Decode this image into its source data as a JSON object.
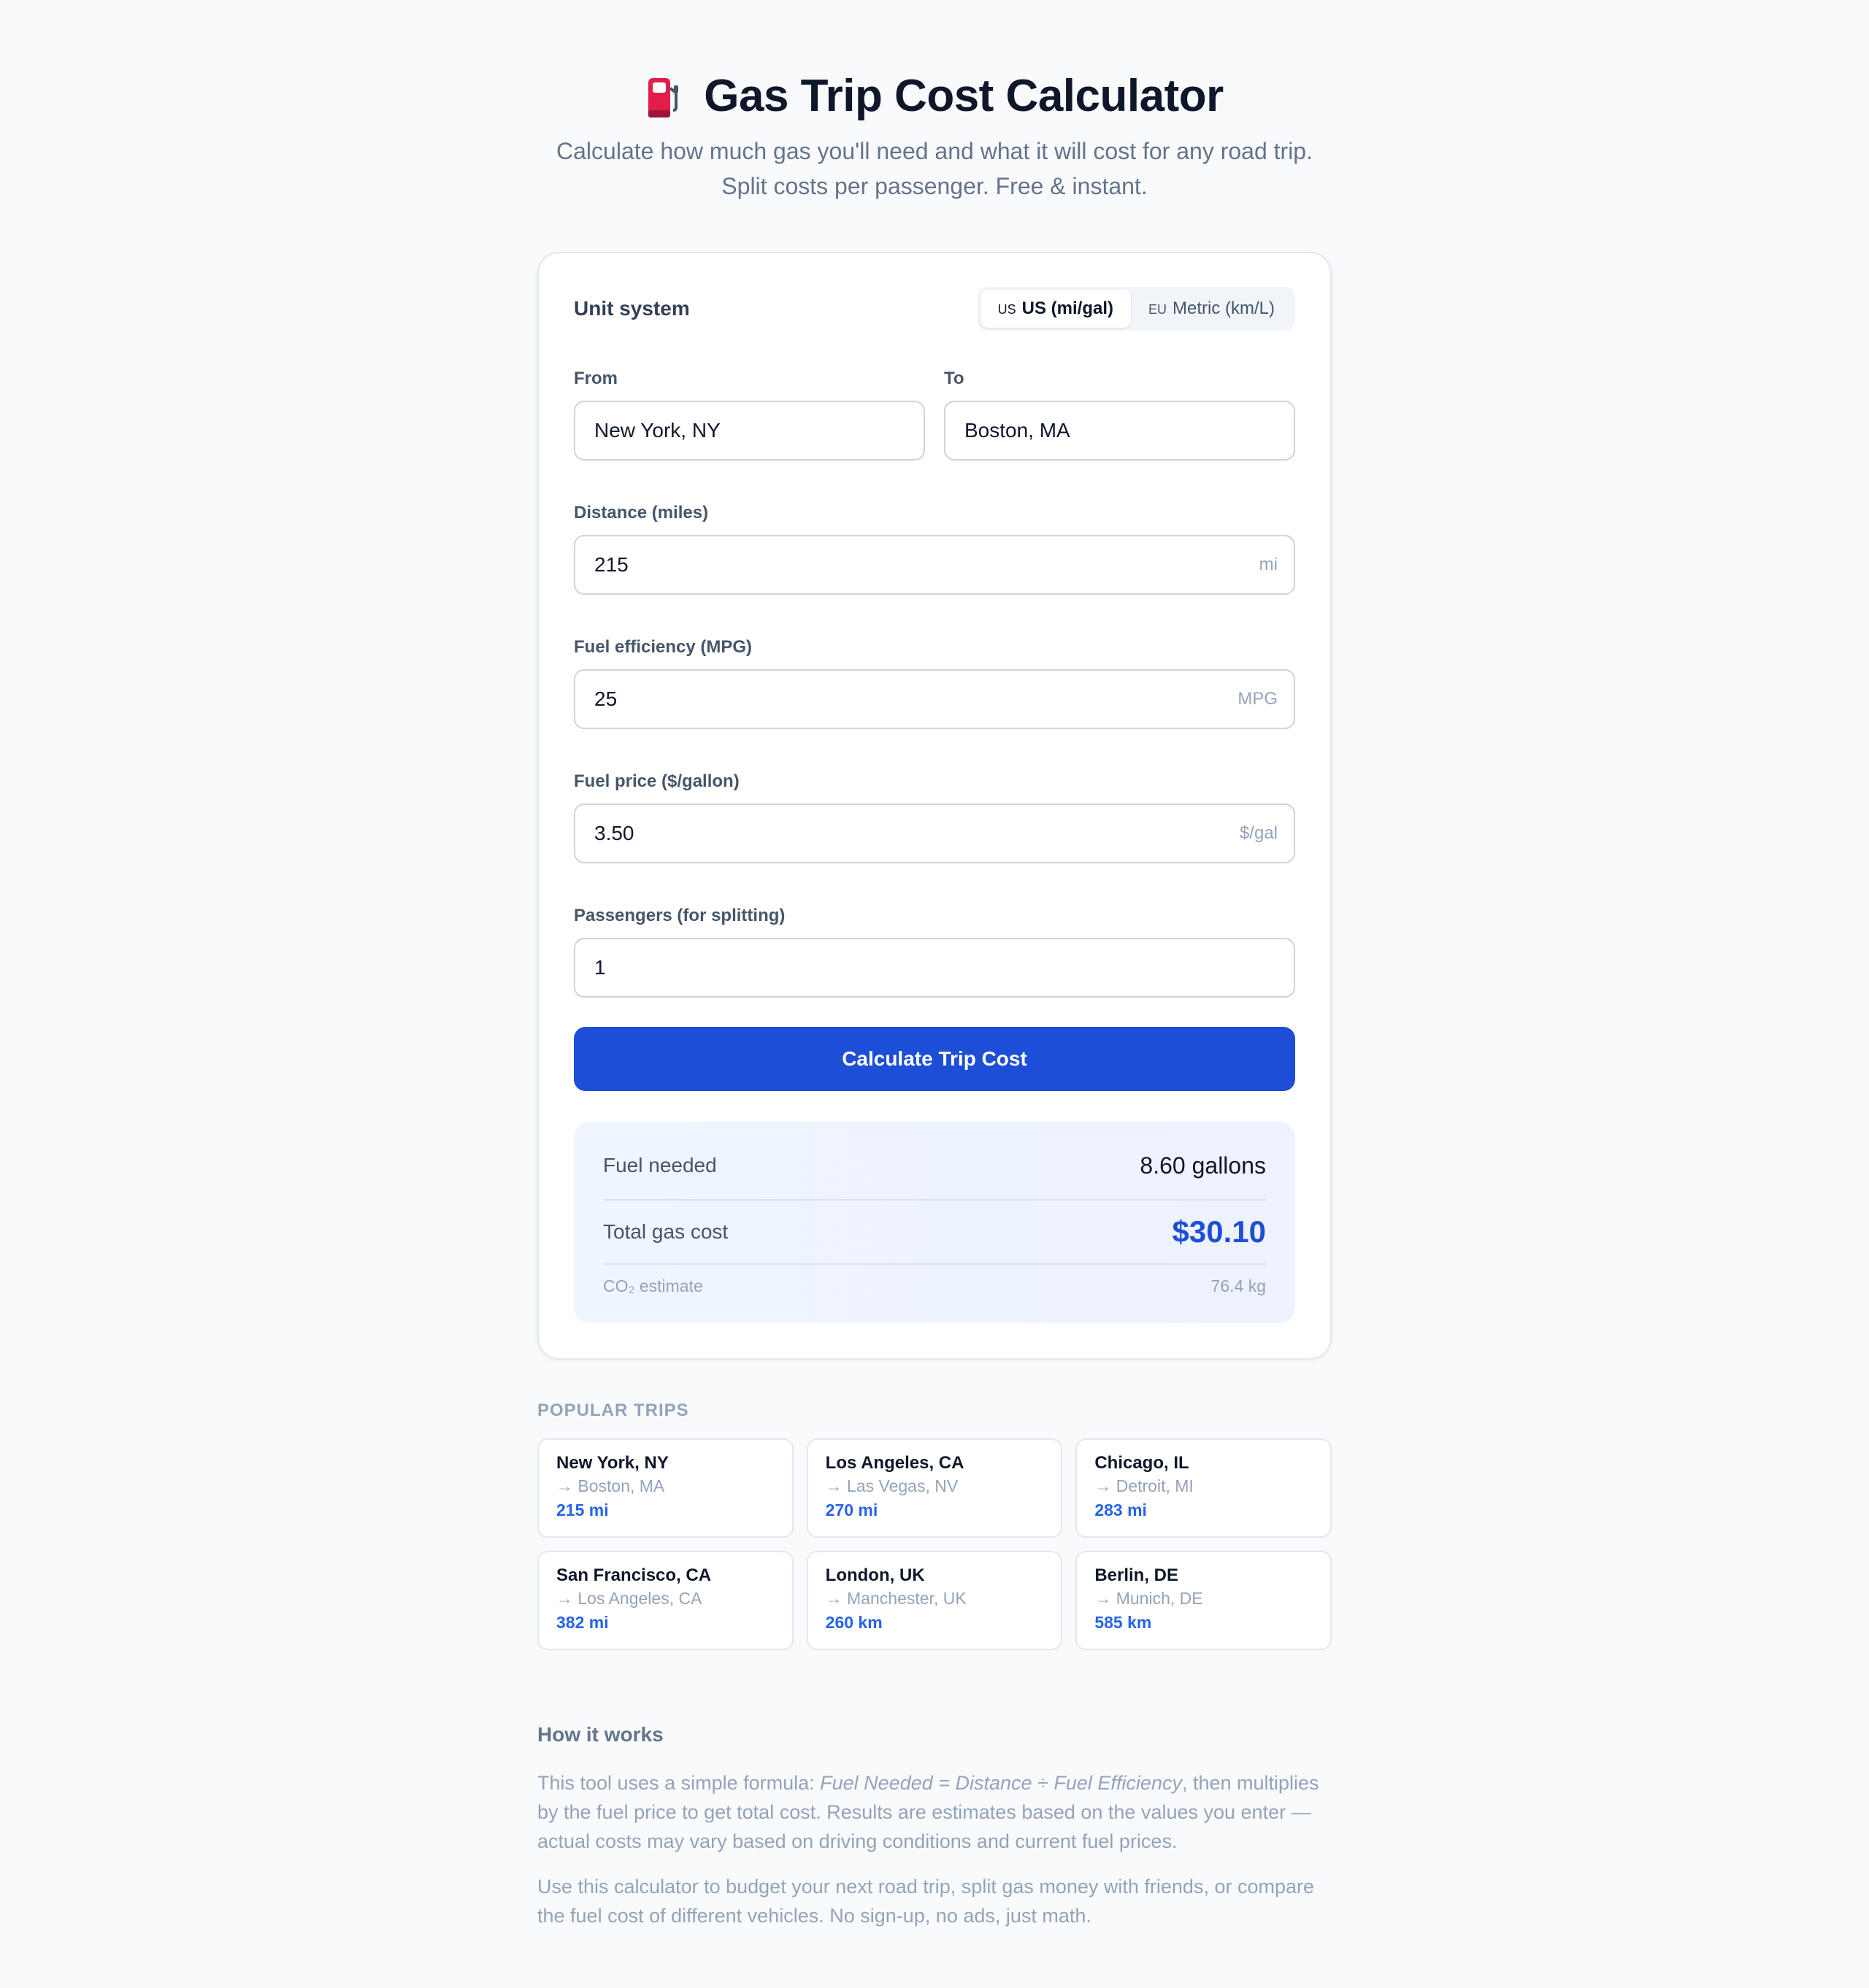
{
  "header": {
    "title": "Gas Trip Cost Calculator",
    "subtitle_line1": "Calculate how much gas you'll need and what it will cost for any road trip.",
    "subtitle_line2": "Split costs per passenger. Free & instant.",
    "icon": "fuel-pump-icon"
  },
  "unit_system": {
    "label": "Unit system",
    "options": [
      {
        "code": "US",
        "label": "US (mi/gal)",
        "active": true
      },
      {
        "code": "EU",
        "label": "Metric (km/L)",
        "active": false
      }
    ]
  },
  "form": {
    "from": {
      "label": "From",
      "value": "New York, NY"
    },
    "to": {
      "label": "To",
      "value": "Boston, MA"
    },
    "distance": {
      "label": "Distance (miles)",
      "value": "215",
      "suffix": "mi"
    },
    "efficiency": {
      "label": "Fuel efficiency (MPG)",
      "value": "25",
      "suffix": "MPG"
    },
    "price": {
      "label": "Fuel price ($/gallon)",
      "value": "3.50",
      "suffix": "$/gal"
    },
    "passengers": {
      "label": "Passengers (for splitting)",
      "value": "1"
    },
    "submit_label": "Calculate Trip Cost"
  },
  "results": {
    "fuel_label": "Fuel needed",
    "fuel_value": "8.60 gallons",
    "total_label": "Total gas cost",
    "total_value": "$30.10",
    "co2_label": "CO₂ estimate",
    "co2_value": "76.4 kg"
  },
  "popular": {
    "title": "POPULAR TRIPS",
    "trips": [
      {
        "from": "New York, NY",
        "to": "→ Boston, MA",
        "distance": "215 mi"
      },
      {
        "from": "Los Angeles, CA",
        "to": "→ Las Vegas, NV",
        "distance": "270 mi"
      },
      {
        "from": "Chicago, IL",
        "to": "→ Detroit, MI",
        "distance": "283 mi"
      },
      {
        "from": "San Francisco, CA",
        "to": "→ Los Angeles, CA",
        "distance": "382 mi"
      },
      {
        "from": "London, UK",
        "to": "→ Manchester, UK",
        "distance": "260 km"
      },
      {
        "from": "Berlin, DE",
        "to": "→ Munich, DE",
        "distance": "585 km"
      }
    ]
  },
  "how": {
    "title": "How it works",
    "p1_a": "This tool uses a simple formula: ",
    "p1_formula": "Fuel Needed = Distance ÷ Fuel Efficiency",
    "p1_b": ", then multiplies by the fuel price to get total cost. Results are estimates based on the values you enter — actual costs may vary based on driving conditions and current fuel prices.",
    "p2": "Use this calculator to budget your next road trip, split gas money with friends, or compare the fuel cost of different vehicles. No sign-up, no ads, just math."
  },
  "colors": {
    "accent": "#1d4ed8",
    "pump": "#e11d48"
  }
}
